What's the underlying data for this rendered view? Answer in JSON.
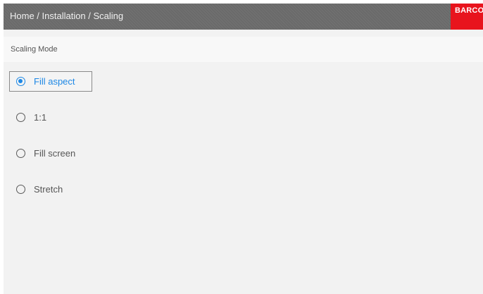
{
  "header": {
    "breadcrumb": "Home / Installation / Scaling",
    "logo_text": "BARCO"
  },
  "section": {
    "title": "Scaling Mode"
  },
  "options": [
    {
      "label": "Fill aspect",
      "selected": true
    },
    {
      "label": "1:1",
      "selected": false
    },
    {
      "label": "Fill screen",
      "selected": false
    },
    {
      "label": "Stretch",
      "selected": false
    }
  ],
  "colors": {
    "titlebar": "#6a6a6a",
    "logo": "#e8141d",
    "accent": "#1e88e5",
    "background": "#f2f2f2"
  }
}
